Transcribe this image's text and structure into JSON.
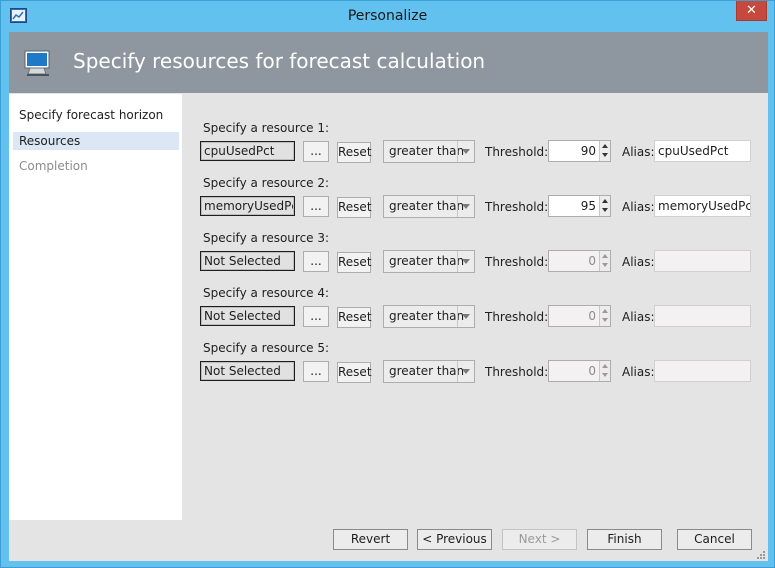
{
  "window": {
    "title": "Personalize",
    "close_label": "✕"
  },
  "header": {
    "title": "Specify resources for forecast calculation"
  },
  "nav": {
    "items": [
      {
        "label": "Specify forecast horizon"
      },
      {
        "label": "Resources"
      },
      {
        "label": "Completion"
      }
    ]
  },
  "resources": [
    {
      "label": "Specify a resource 1:",
      "metric": "cpuUsedPct",
      "browse": "...",
      "reset": "Reset",
      "condition": "greater than",
      "threshold_label": "Threshold:",
      "threshold": "90",
      "alias_label": "Alias:",
      "alias": "cpuUsedPct"
    },
    {
      "label": "Specify a resource 2:",
      "metric": "memoryUsedPct",
      "browse": "...",
      "reset": "Reset",
      "condition": "greater than",
      "threshold_label": "Threshold:",
      "threshold": "95",
      "alias_label": "Alias:",
      "alias": "memoryUsedPct"
    },
    {
      "label": "Specify a resource 3:",
      "metric": "Not Selected",
      "browse": "...",
      "reset": "Reset",
      "condition": "greater than",
      "threshold_label": "Threshold:",
      "threshold": "0",
      "alias_label": "Alias:",
      "alias": ""
    },
    {
      "label": "Specify a resource 4:",
      "metric": "Not Selected",
      "browse": "...",
      "reset": "Reset",
      "condition": "greater than",
      "threshold_label": "Threshold:",
      "threshold": "0",
      "alias_label": "Alias:",
      "alias": ""
    },
    {
      "label": "Specify a resource 5:",
      "metric": "Not Selected",
      "browse": "...",
      "reset": "Reset",
      "condition": "greater than",
      "threshold_label": "Threshold:",
      "threshold": "0",
      "alias_label": "Alias:",
      "alias": ""
    }
  ],
  "footer": {
    "revert": "Revert",
    "previous": "< Previous",
    "next": "Next >",
    "finish": "Finish",
    "cancel": "Cancel"
  },
  "colors": {
    "titlebar": "#62c1ee",
    "header": "#8e979f",
    "nav_selected": "#dbe7f4",
    "close": "#c7483c"
  }
}
